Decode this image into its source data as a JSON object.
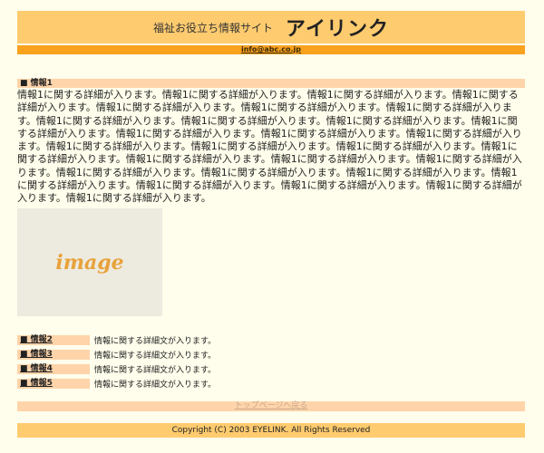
{
  "header": {
    "tagline": "福祉お役立ち情報サイト",
    "site_name": "アイリンク",
    "email": "info@abc.co.jp"
  },
  "section1": {
    "title": "■ 情報1",
    "body": "情報1に関する詳細が入ります。情報1に関する詳細が入ります。情報1に関する詳細が入ります。情報1に関する詳細が入ります。情報1に関する詳細が入ります。情報1に関する詳細が入ります。情報1に関する詳細が入ります。情報1に関する詳細が入ります。情報1に関する詳細が入ります。情報1に関する詳細が入ります。情報1に関する詳細が入ります。情報1に関する詳細が入ります。情報1に関する詳細が入ります。情報1に関する詳細が入ります。情報1に関する詳細が入ります。情報1に関する詳細が入ります。情報1に関する詳細が入ります。情報1に関する詳細が入ります。情報1に関する詳細が入ります。情報1に関する詳細が入ります。情報1に関する詳細が入ります。情報1に関する詳細が入ります。情報1に関する詳細が入ります。情報1に関する詳細が入ります。情報1に関する詳細が入ります。情報1に関する詳細が入ります。情報1に関する詳細が入ります。情報1に関する詳細が入ります。情報1に関する詳細が入ります。"
  },
  "image_placeholder": "image",
  "info_items": [
    {
      "label": "■ 情報2",
      "desc": "情報に関する詳細文が入ります。"
    },
    {
      "label": "■ 情報3",
      "desc": "情報に関する詳細文が入ります。"
    },
    {
      "label": "■ 情報4",
      "desc": "情報に関する詳細文が入ります。"
    },
    {
      "label": "■ 情報5",
      "desc": "情報に関する詳細文が入ります。"
    }
  ],
  "top_link": "トップページへ戻る",
  "footer": "Copyright (C) 2003 EYELINK. All Rights Reserved"
}
